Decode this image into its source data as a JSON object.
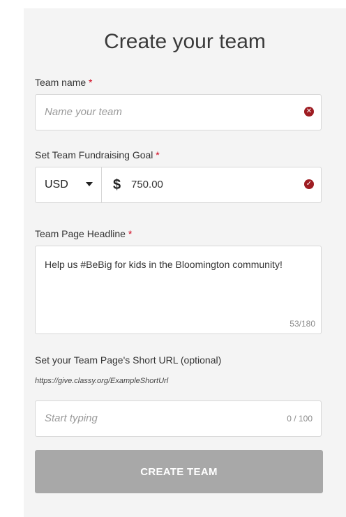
{
  "form": {
    "title": "Create your team",
    "required_marker": "*",
    "team_name": {
      "label": "Team name",
      "placeholder": "Name your team",
      "value": "",
      "status": "error",
      "status_icon": "error-x-icon"
    },
    "goal": {
      "label": "Set Team Fundraising Goal",
      "currency": "USD",
      "currency_symbol": "$",
      "amount": "750.00",
      "status": "valid",
      "status_icon": "check-icon"
    },
    "headline": {
      "label": "Team Page Headline",
      "value": "Help us #BeBig for kids in the Bloomington community!",
      "counter": "53/180"
    },
    "short_url": {
      "label": "Set your Team Page's Short URL (optional)",
      "example": "https://give.classy.org/ExampleShortUrl",
      "placeholder": "Start typing",
      "value": "",
      "counter": "0 / 100"
    },
    "submit_label": "CREATE TEAM"
  },
  "colors": {
    "panel_background": "#f4f4f4",
    "required": "#d0021b",
    "status_icon": "#9e1c22",
    "button_disabled": "#a8a8a8"
  }
}
